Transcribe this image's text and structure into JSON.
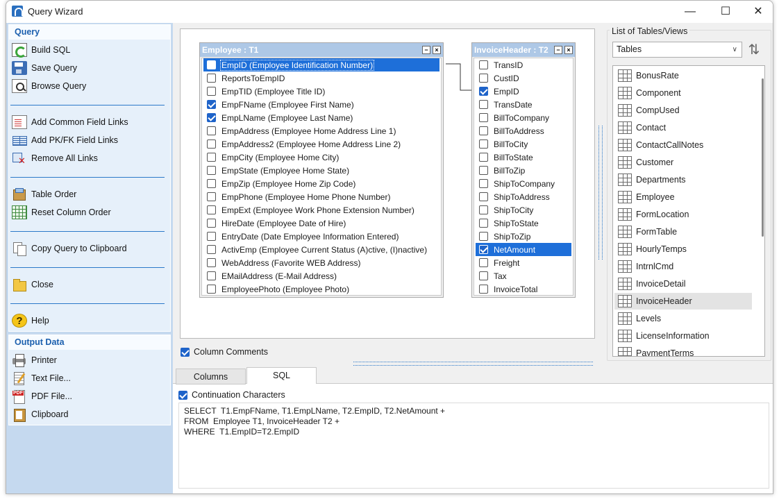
{
  "window": {
    "title": "Query Wizard",
    "minimize": "—",
    "maximize": "☐",
    "close": "✕"
  },
  "left_panel": {
    "query_header": "Query",
    "actions": [
      {
        "label": "Build SQL",
        "icon": "build-sql-icon"
      },
      {
        "label": "Save Query",
        "icon": "save-icon"
      },
      {
        "label": "Browse Query",
        "icon": "browse-icon"
      },
      {
        "label": "Add Common Field Links",
        "icon": "link-icon"
      },
      {
        "label": "Add PK/FK Field Links",
        "icon": "pk-fk-link-icon"
      },
      {
        "label": "Remove All Links",
        "icon": "remove-links-icon"
      },
      {
        "label": "Table Order",
        "icon": "table-order-icon"
      },
      {
        "label": "Reset Column Order",
        "icon": "grid-icon"
      },
      {
        "label": "Copy Query to Clipboard",
        "icon": "copy-icon"
      },
      {
        "label": "Close",
        "icon": "folder-close-icon"
      },
      {
        "label": "Help",
        "icon": "help-icon"
      }
    ],
    "output_header": "Output Data",
    "outputs": [
      {
        "label": "Printer",
        "icon": "printer-icon"
      },
      {
        "label": "Text File...",
        "icon": "text-file-icon"
      },
      {
        "label": "PDF File...",
        "icon": "pdf-file-icon"
      },
      {
        "label": "Clipboard",
        "icon": "clipboard-icon"
      }
    ]
  },
  "tables": {
    "employee": {
      "title": "Employee : T1",
      "fields": [
        {
          "name": "EmpID  (Employee Identification Number)",
          "checked": false,
          "selected": true
        },
        {
          "name": "ReportsToEmpID",
          "checked": false
        },
        {
          "name": "EmpTID  (Employee Title ID)",
          "checked": false
        },
        {
          "name": "EmpFName  (Employee First Name)",
          "checked": true
        },
        {
          "name": "EmpLName  (Employee Last Name)",
          "checked": true
        },
        {
          "name": "EmpAddress  (Employee Home Address Line 1)",
          "checked": false
        },
        {
          "name": "EmpAddress2  (Employee Home Address Line 2)",
          "checked": false
        },
        {
          "name": "EmpCity  (Employee Home City)",
          "checked": false
        },
        {
          "name": "EmpState  (Employee Home State)",
          "checked": false
        },
        {
          "name": "EmpZip  (Employee Home Zip Code)",
          "checked": false
        },
        {
          "name": "EmpPhone  (Employee Home Phone Number)",
          "checked": false
        },
        {
          "name": "EmpExt  (Employee Work Phone Extension Number)",
          "checked": false
        },
        {
          "name": "HireDate  (Employee Date of Hire)",
          "checked": false
        },
        {
          "name": "EntryDate  (Date Employee Information Entered)",
          "checked": false
        },
        {
          "name": "ActivEmp  (Employee Current Status (A)ctive, (I)nactive)",
          "checked": false
        },
        {
          "name": "WebAddress  (Favorite WEB Address)",
          "checked": false
        },
        {
          "name": "EMailAddress  (E-Mail Address)",
          "checked": false
        },
        {
          "name": "EmployeePhoto  (Employee Photo)",
          "checked": false
        }
      ]
    },
    "invoice": {
      "title": "InvoiceHeader : T2",
      "fields": [
        {
          "name": "TransID",
          "checked": false
        },
        {
          "name": "CustID",
          "checked": false
        },
        {
          "name": "EmpID",
          "checked": true
        },
        {
          "name": "TransDate",
          "checked": false
        },
        {
          "name": "BillToCompany",
          "checked": false
        },
        {
          "name": "BillToAddress",
          "checked": false
        },
        {
          "name": "BillToCity",
          "checked": false
        },
        {
          "name": "BillToState",
          "checked": false
        },
        {
          "name": "BillToZip",
          "checked": false
        },
        {
          "name": "ShipToCompany",
          "checked": false
        },
        {
          "name": "ShipToAddress",
          "checked": false
        },
        {
          "name": "ShipToCity",
          "checked": false
        },
        {
          "name": "ShipToState",
          "checked": false
        },
        {
          "name": "ShipToZip",
          "checked": false
        },
        {
          "name": "NetAmount",
          "checked": true,
          "selected": true
        },
        {
          "name": "Freight",
          "checked": false
        },
        {
          "name": "Tax",
          "checked": false
        },
        {
          "name": "InvoiceTotal",
          "checked": false
        }
      ]
    }
  },
  "column_comments": {
    "label": "Column Comments",
    "checked": true
  },
  "right_panel": {
    "label": "List of Tables/Views",
    "combo_value": "Tables",
    "tables": [
      "BonusRate",
      "Component",
      "CompUsed",
      "Contact",
      "ContactCallNotes",
      "Customer",
      "Departments",
      "Employee",
      "FormLocation",
      "FormTable",
      "HourlyTemps",
      "IntrnlCmd",
      "InvoiceDetail",
      "InvoiceHeader",
      "Levels",
      "LicenseInformation",
      "PaymentTerms"
    ],
    "highlighted": "InvoiceHeader"
  },
  "tabs": {
    "columns": "Columns",
    "sql": "SQL"
  },
  "sql": {
    "continuation_label": "Continuation Characters",
    "continuation_checked": true,
    "lines": [
      "SELECT  T1.EmpFName, T1.EmpLName, T2.EmpID, T2.NetAmount +",
      "FROM  Employee T1, InvoiceHeader T2 +",
      "WHERE  T1.EmpID=T2.EmpID"
    ]
  },
  "colors": {
    "accent": "#1e6fd9",
    "panel": "#c5d9ef",
    "header_text": "#1b5fae",
    "table_head": "#aec8e6"
  }
}
